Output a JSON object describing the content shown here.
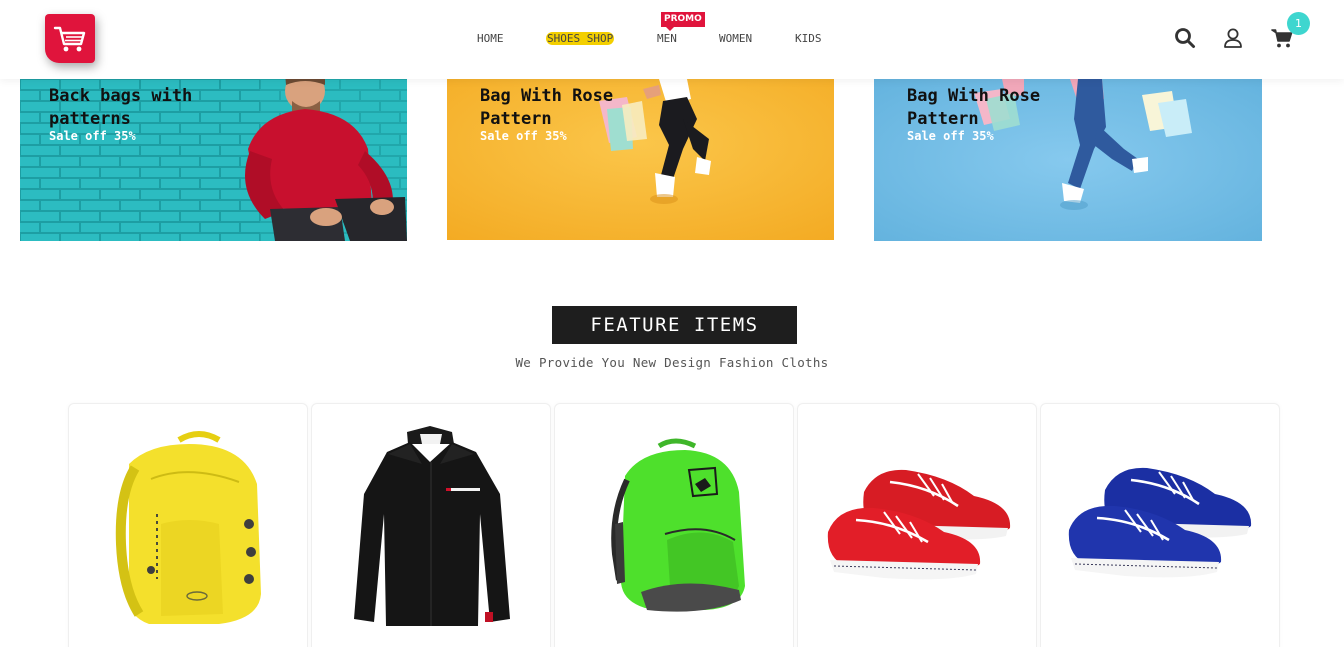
{
  "header": {
    "logo_icon": "shopping-cart-icon",
    "nav": [
      {
        "label": "HOME"
      },
      {
        "label": "SHOES SHOP",
        "highlight": "#f3cf00"
      },
      {
        "label": "MEN",
        "badge": "PROMO"
      },
      {
        "label": "WOMEN"
      },
      {
        "label": "KIDS"
      }
    ],
    "icons": [
      "search-icon",
      "user-icon",
      "cart-icon"
    ],
    "cart_count": "1"
  },
  "banners": [
    {
      "title": "Back bags with patterns",
      "subtitle": "Sale off 35%",
      "background": "#2fbfc4"
    },
    {
      "title": "Bag With Rose Pattern",
      "subtitle": "Sale off 35%",
      "background": "#f7b733"
    },
    {
      "title": "Bag With Rose Pattern",
      "subtitle": "Sale off 35%",
      "background": "#6fb8df"
    }
  ],
  "feature": {
    "title": "FEATURE ITEMS",
    "subtitle": "We Provide You New Design Fashion Cloths"
  },
  "products": [
    {
      "image": "yellow-backpack"
    },
    {
      "image": "black-shirt"
    },
    {
      "image": "green-backpack"
    },
    {
      "image": "red-boat-shoes"
    },
    {
      "image": "blue-boat-shoes"
    }
  ],
  "colors": {
    "accent": "#e0143c",
    "badge": "#3ed6cf",
    "highlight": "#f3cf00",
    "dark": "#1e1e1e"
  }
}
